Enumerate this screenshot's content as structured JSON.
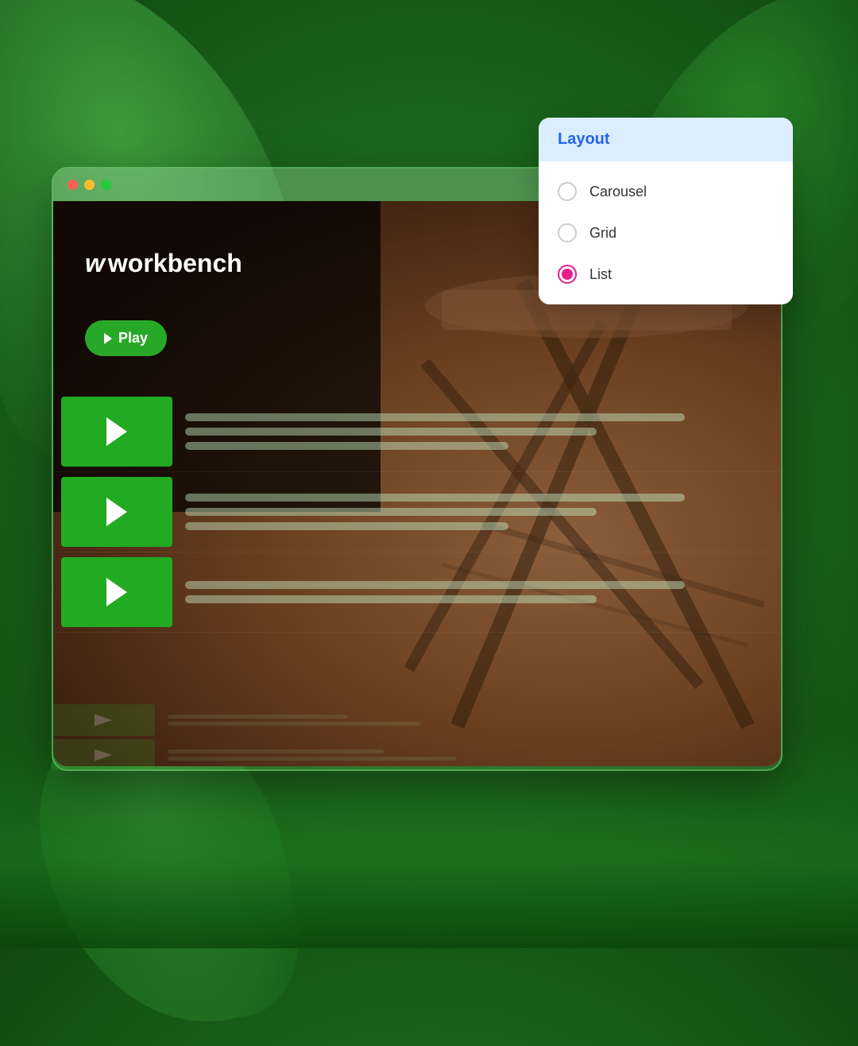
{
  "background": {
    "colors": {
      "bg_start": "#3a9c3a",
      "bg_mid": "#1e6b1e",
      "bg_end": "#0f4a0f"
    }
  },
  "window": {
    "title": "workbench",
    "logo_w": "w",
    "logo_text": "workbench",
    "play_button": "Play",
    "traffic_lights": [
      "red",
      "yellow",
      "green"
    ]
  },
  "list_items": [
    {
      "id": 1,
      "text_lines": [
        "long",
        "medium"
      ]
    },
    {
      "id": 2,
      "text_lines": [
        "medium",
        "short"
      ]
    },
    {
      "id": 3,
      "text_lines": [
        "long",
        "medium"
      ]
    }
  ],
  "reflection_items": [
    {
      "id": 1,
      "lines": [
        "long",
        "medium"
      ]
    },
    {
      "id": 2,
      "lines": [
        "medium",
        "short"
      ]
    }
  ],
  "layout_panel": {
    "header": "Layout",
    "options": [
      {
        "id": "carousel",
        "label": "Carousel",
        "selected": false
      },
      {
        "id": "grid",
        "label": "Grid",
        "selected": false
      },
      {
        "id": "list",
        "label": "List",
        "selected": true
      }
    ]
  }
}
